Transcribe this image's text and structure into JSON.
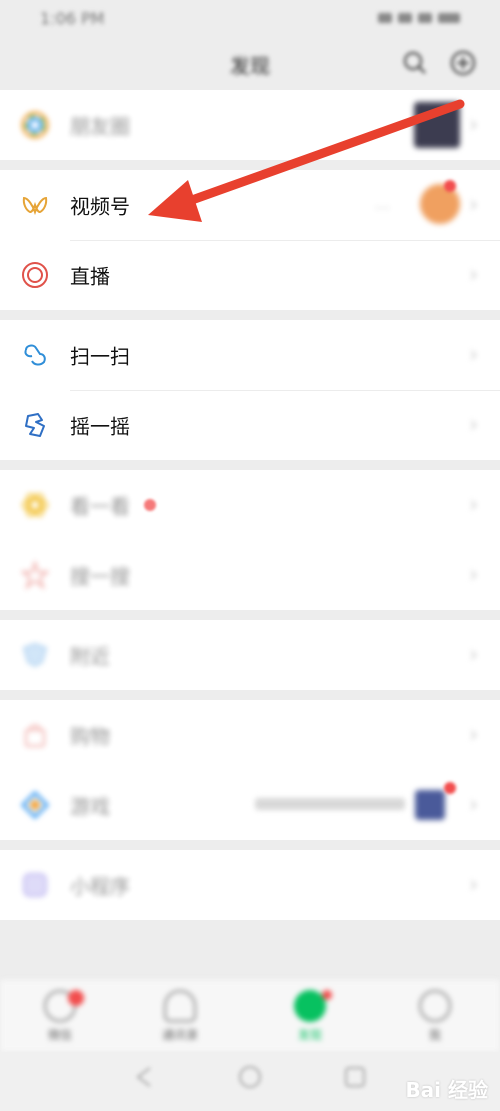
{
  "status_bar": {
    "time": "1:06 PM"
  },
  "header": {
    "title": "发现",
    "icons": [
      "search-icon",
      "add-icon"
    ]
  },
  "groups": [
    {
      "items": [
        {
          "label": "朋友圈",
          "icon": "moments-icon",
          "blurred": true
        }
      ]
    },
    {
      "items": [
        {
          "label": "视频号",
          "icon": "channels-icon",
          "detail": "...",
          "has_dot": true
        },
        {
          "label": "直播",
          "icon": "live-icon"
        }
      ]
    },
    {
      "items": [
        {
          "label": "扫一扫",
          "icon": "scan-icon"
        },
        {
          "label": "摇一摇",
          "icon": "shake-icon"
        }
      ]
    },
    {
      "items": [
        {
          "label": "看一看",
          "icon": "top-stories-icon",
          "has_dot": true
        },
        {
          "label": "搜一搜",
          "icon": "search-feature-icon",
          "blurred": true
        }
      ]
    },
    {
      "items": [
        {
          "label": "附近",
          "icon": "nearby-icon",
          "blurred": true
        }
      ]
    },
    {
      "items": [
        {
          "label": "购物",
          "icon": "shopping-icon",
          "blurred": true
        },
        {
          "label": "游戏",
          "icon": "games-icon",
          "blurred": true,
          "has_dot": true
        }
      ]
    },
    {
      "items": [
        {
          "label": "小程序",
          "icon": "mini-programs-icon",
          "blurred": true
        }
      ]
    }
  ],
  "bottom_nav": {
    "items": [
      {
        "label": "微信",
        "icon": "chats-icon",
        "color": "#888888"
      },
      {
        "label": "通讯录",
        "icon": "contacts-icon",
        "color": "#888888"
      },
      {
        "label": "发现",
        "icon": "discover-icon",
        "color": "#07c160"
      },
      {
        "label": "我",
        "icon": "me-icon",
        "color": "#888888"
      }
    ]
  },
  "watermark": "Bai 经验",
  "colors": {
    "accent_green": "#07c160",
    "arrow_red": "#e8402e",
    "dot_red": "#f24d4d",
    "background": "#ededed"
  }
}
